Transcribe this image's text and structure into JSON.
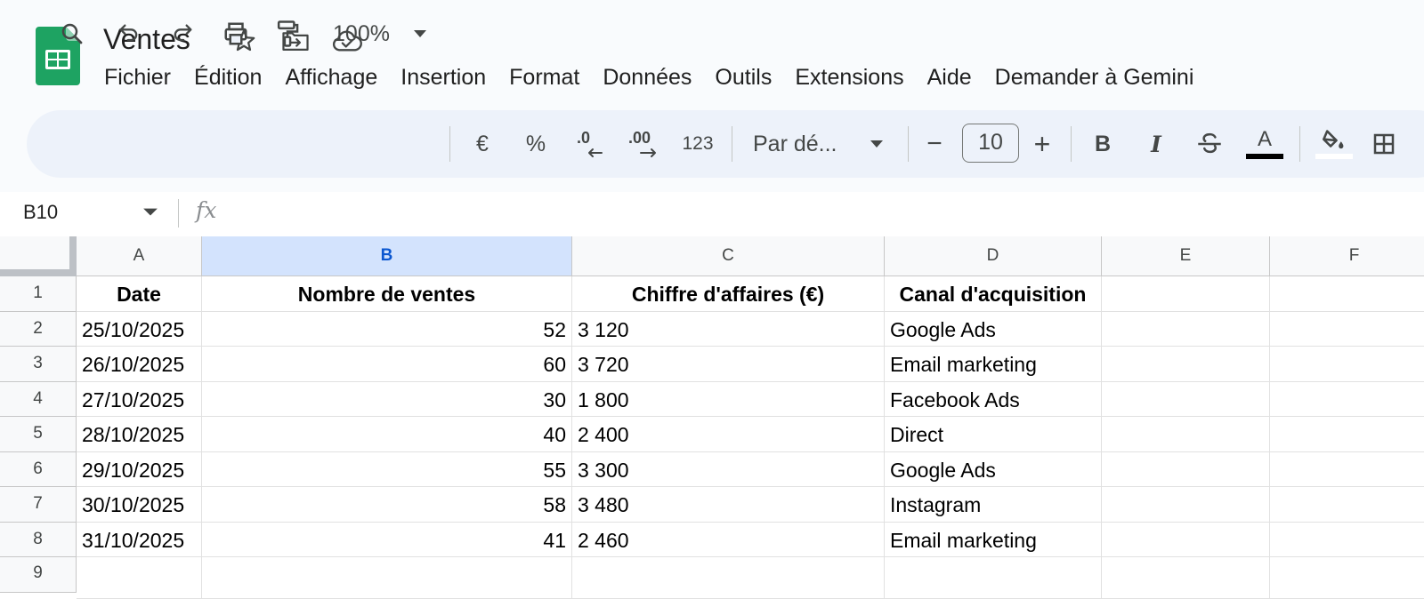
{
  "app": {
    "document_title": "Ventes",
    "logo_icon": "google-sheets-logo",
    "title_icons": [
      "star-icon",
      "move-folder-icon",
      "cloud-saved-icon"
    ]
  },
  "menu": {
    "file": "Fichier",
    "edit": "Édition",
    "view": "Affichage",
    "insert": "Insertion",
    "format": "Format",
    "data": "Données",
    "tools": "Outils",
    "extensions": "Extensions",
    "help": "Aide",
    "gemini": "Demander à Gemini"
  },
  "toolbar": {
    "zoom": "100%",
    "currency": "€",
    "percent": "%",
    "decrease_decimals": ".0",
    "increase_decimals": ".00",
    "more_formats": "123",
    "font": "Par dé...",
    "minus": "−",
    "font_size": "10",
    "plus": "+",
    "bold": "B",
    "italic": "I",
    "text_color_letter": "A",
    "text_color": "#000000"
  },
  "formula_bar": {
    "name_box": "B10",
    "fx": "fx",
    "content": ""
  },
  "sheet": {
    "columns": [
      "A",
      "B",
      "C",
      "D",
      "E",
      "F"
    ],
    "selected_column": "B",
    "row_numbers": [
      "1",
      "2",
      "3",
      "4",
      "5",
      "6",
      "7",
      "8",
      "9"
    ],
    "headers": {
      "a": "Date",
      "b": "Nombre de ventes",
      "c": "Chiffre d'affaires (€)",
      "d": "Canal d'acquisition"
    },
    "rows": [
      {
        "date": "25/10/2025",
        "ventes": "52",
        "ca": "3 120",
        "canal": "Google Ads"
      },
      {
        "date": "26/10/2025",
        "ventes": "60",
        "ca": "3 720",
        "canal": "Email marketing"
      },
      {
        "date": "27/10/2025",
        "ventes": "30",
        "ca": "1 800",
        "canal": "Facebook Ads"
      },
      {
        "date": "28/10/2025",
        "ventes": "40",
        "ca": "2 400",
        "canal": "Direct"
      },
      {
        "date": "29/10/2025",
        "ventes": "55",
        "ca": "3 300",
        "canal": "Google Ads"
      },
      {
        "date": "30/10/2025",
        "ventes": "58",
        "ca": "3 480",
        "canal": "Instagram"
      },
      {
        "date": "31/10/2025",
        "ventes": "41",
        "ca": "2 460",
        "canal": "Email marketing"
      }
    ]
  }
}
